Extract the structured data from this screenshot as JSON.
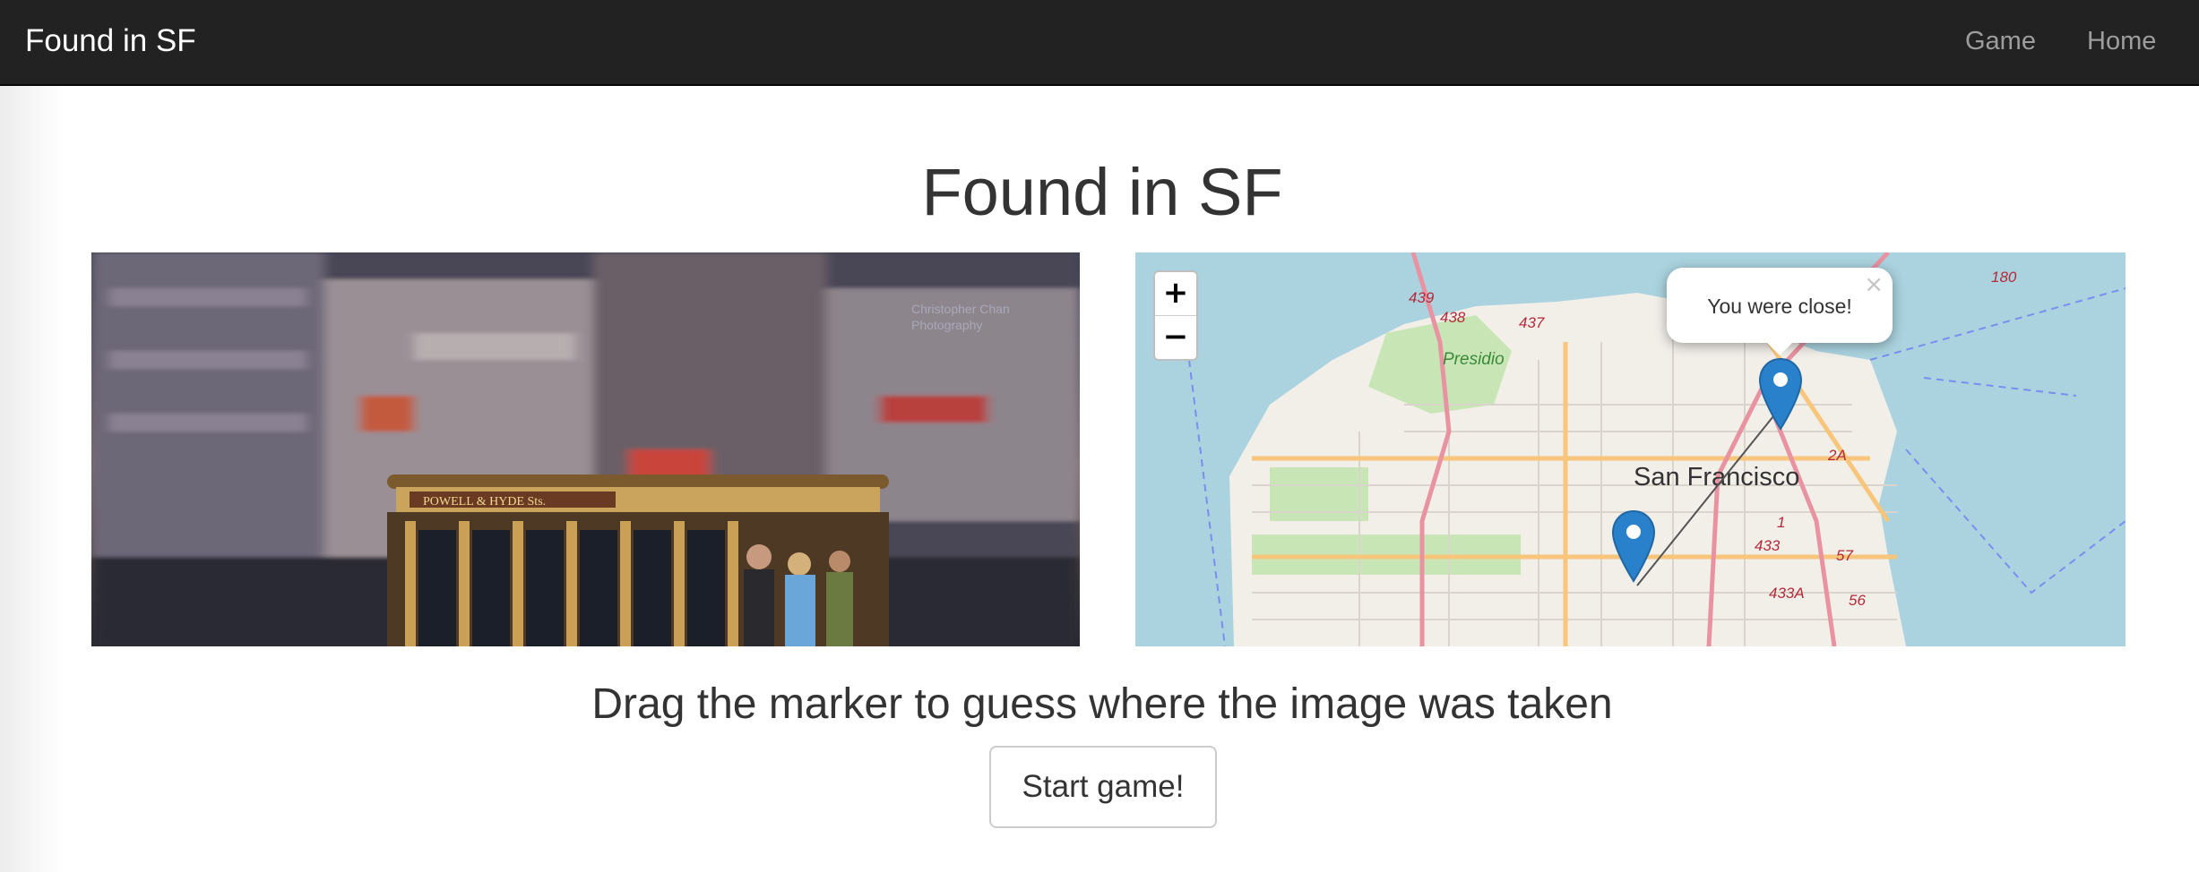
{
  "navbar": {
    "brand": "Found in SF",
    "links": [
      {
        "label": "Game"
      },
      {
        "label": "Home"
      }
    ]
  },
  "main": {
    "title": "Found in SF",
    "photo": {
      "sign_text": "POWELL & HYDE Sts.",
      "watermark_line1": "Christopher Chan",
      "watermark_line2": "Photography"
    },
    "map": {
      "zoom_in": "+",
      "zoom_out": "−",
      "popup_text": "You were close!",
      "popup_close": "×",
      "city_label": "San Francisco",
      "park_label": "Presidio",
      "road_shields": [
        "439",
        "438",
        "437",
        "180",
        "2A",
        "1",
        "433",
        "57",
        "433A",
        "56"
      ]
    },
    "instruction": "Drag the marker to guess where the image was taken",
    "start_button": "Start game!"
  },
  "colors": {
    "navbar_bg": "#222222",
    "water": "#aad3df",
    "land": "#f2efe9",
    "park": "#c8e6b5",
    "marker": "#2a81cb"
  }
}
